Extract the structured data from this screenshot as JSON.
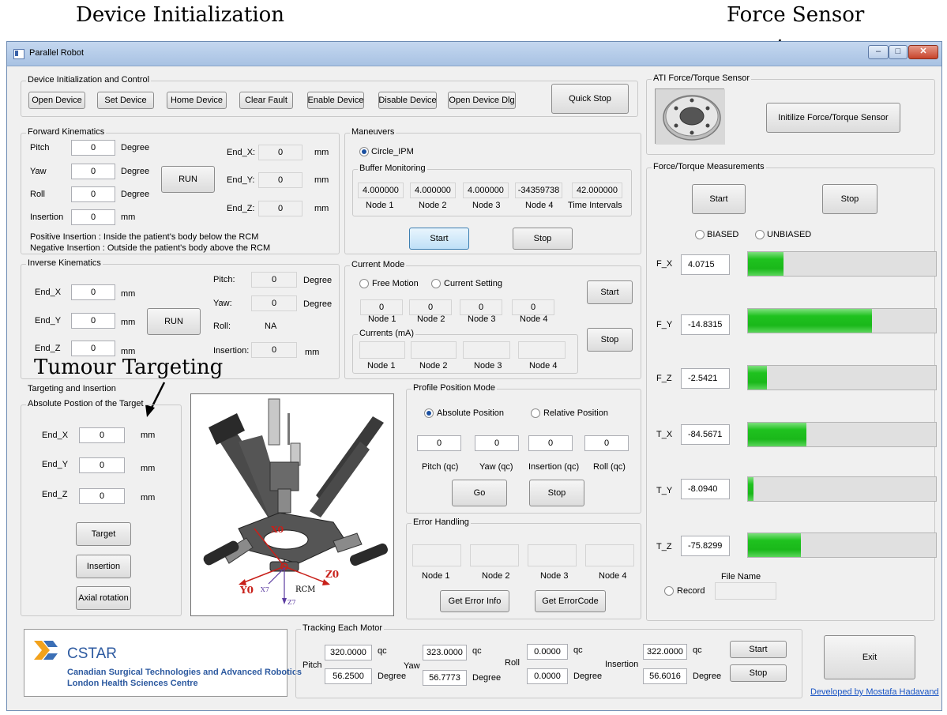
{
  "callouts": {
    "device_init": "Device Initialization",
    "force_sensor": "Force Sensor",
    "tumour_targeting": "Tumour Targeting"
  },
  "window": {
    "title": "Parallel Robot",
    "min_icon": "minimize-icon",
    "max_icon": "maximize-icon",
    "close_icon": "close-icon"
  },
  "device": {
    "group_title": "Device Initialization and Control",
    "buttons": [
      "Open Device",
      "Set Device",
      "Home Device",
      "Clear Fault",
      "Enable Device",
      "Disable Device",
      "Open Device Dlg"
    ],
    "quick_stop": "Quick Stop"
  },
  "ati": {
    "group_title": "ATI Force/Torque Sensor",
    "init_button": "Initilize Force/Torque Sensor"
  },
  "forward": {
    "group_title": "Forward Kinematics",
    "pitch_label": "Pitch",
    "pitch_value": "0",
    "pitch_unit": "Degree",
    "yaw_label": "Yaw",
    "yaw_value": "0",
    "yaw_unit": "Degree",
    "roll_label": "Roll",
    "roll_value": "0",
    "roll_unit": "Degree",
    "insertion_label": "Insertion",
    "insertion_value": "0",
    "insertion_unit": "mm",
    "run": "RUN",
    "endx_label": "End_X:",
    "endx_value": "0",
    "endx_unit": "mm",
    "endy_label": "End_Y:",
    "endy_value": "0",
    "endy_unit": "mm",
    "endz_label": "End_Z:",
    "endz_value": "0",
    "endz_unit": "mm",
    "note1": "Positive Insertion : Inside the patient's body below the RCM",
    "note2": "Negative Insertion : Outside the patient's body above the RCM"
  },
  "inverse": {
    "group_title": "Inverse Kinematics",
    "endx_label": "End_X",
    "endx_value": "0",
    "endx_unit": "mm",
    "endy_label": "End_Y",
    "endy_value": "0",
    "endy_unit": "mm",
    "endz_label": "End_Z",
    "endz_value": "0",
    "endz_unit": "mm",
    "run": "RUN",
    "pitch_label": "Pitch:",
    "pitch_value": "0",
    "pitch_unit": "Degree",
    "yaw_label": "Yaw:",
    "yaw_value": "0",
    "yaw_unit": "Degree",
    "roll_label": "Roll:",
    "roll_value": "NA",
    "insertion_label": "Insertion:",
    "insertion_value": "0",
    "insertion_unit": "mm"
  },
  "maneuvers": {
    "group_title": "Maneuvers",
    "circle_option": "Circle_IPM",
    "buffer_title": "Buffer Monitoring",
    "buffer_values": [
      "4.000000",
      "4.000000",
      "4.000000",
      "-34359738",
      "42.000000"
    ],
    "buffer_labels": [
      "Node 1",
      "Node 2",
      "Node 3",
      "Node 4",
      "Time Intervals"
    ],
    "start": "Start",
    "stop": "Stop"
  },
  "current": {
    "group_title": "Current Mode",
    "free_motion": "Free Motion",
    "current_setting": "Current Setting",
    "node_values": [
      "0",
      "0",
      "0",
      "0"
    ],
    "node_labels": [
      "Node 1",
      "Node 2",
      "Node 3",
      "Node 4"
    ],
    "currents_title": "Currents (mA)",
    "current_labels": [
      "Node 1",
      "Node 2",
      "Node 3",
      "Node 4"
    ],
    "start": "Start",
    "stop": "Stop"
  },
  "targeting": {
    "group_title": "Targeting and Insertion",
    "sub_title": "Absolute Postion of the Target",
    "endx_label": "End_X",
    "endx_value": "0",
    "endx_unit": "mm",
    "endy_label": "End_Y",
    "endy_value": "0",
    "endy_unit": "mm",
    "endz_label": "End_Z",
    "endz_value": "0",
    "endz_unit": "mm",
    "target": "Target",
    "insertion": "Insertion",
    "axial_rotation": "Axial rotation"
  },
  "robot_image": {
    "x0": "X0",
    "y0": "Y0",
    "z0": "Z0",
    "rcm": "RCM",
    "x7": "X7",
    "z7": "Z7"
  },
  "profile": {
    "group_title": "Profile Position Mode",
    "absolute": "Absolute Position",
    "relative": "Relative Position",
    "values": [
      "0",
      "0",
      "0",
      "0"
    ],
    "labels": [
      "Pitch (qc)",
      "Yaw (qc)",
      "Insertion (qc)",
      "Roll (qc)"
    ],
    "go": "Go",
    "stop": "Stop"
  },
  "error": {
    "group_title": "Error Handling",
    "labels": [
      "Node 1",
      "Node 2",
      "Node 3",
      "Node 4"
    ],
    "get_info": "Get Error Info",
    "get_code": "Get ErrorCode"
  },
  "ft": {
    "group_title": "Force/Torque Measurements",
    "start": "Start",
    "stop": "Stop",
    "biased": "BIASED",
    "unbiased": "UNBIASED",
    "rows": [
      {
        "label": "F_X",
        "value": "4.0715",
        "level": 0.19
      },
      {
        "label": "F_Y",
        "value": "-14.8315",
        "level": 0.66
      },
      {
        "label": "F_Z",
        "value": "-2.5421",
        "level": 0.1
      },
      {
        "label": "T_X",
        "value": "-84.5671",
        "level": 0.31
      },
      {
        "label": "T_Y",
        "value": "-8.0940",
        "level": 0.03
      },
      {
        "label": "T_Z",
        "value": "-75.8299",
        "level": 0.28
      }
    ],
    "file_name_label": "File Name",
    "record": "Record"
  },
  "logo": {
    "name": "CSTAR",
    "line1": "Canadian Surgical Technologies and Advanced Robotics",
    "line2": "London Health Sciences Centre",
    "brand_color": "#f2a21c"
  },
  "tracking": {
    "group_title": "Tracking Each Motor",
    "pitch_label": "Pitch",
    "pitch_qc": "320.0000",
    "pitch_deg": "56.2500",
    "yaw_label": "Yaw",
    "yaw_qc": "323.0000",
    "yaw_deg": "56.7773",
    "roll_label": "Roll",
    "roll_qc": "0.0000",
    "roll_deg": "0.0000",
    "insertion_label": "Insertion",
    "insertion_qc": "322.0000",
    "insertion_deg": "56.6016",
    "qc_unit": "qc",
    "deg_unit": "Degree",
    "start": "Start",
    "stop": "Stop"
  },
  "exit": "Exit",
  "developer": "Developed by Mostafa Hadavand",
  "colors": {
    "bar_green": "#1fc21f",
    "link_blue": "#1a55c4",
    "red_axis": "#c8201a",
    "purple_axis": "#5a3aa0"
  }
}
